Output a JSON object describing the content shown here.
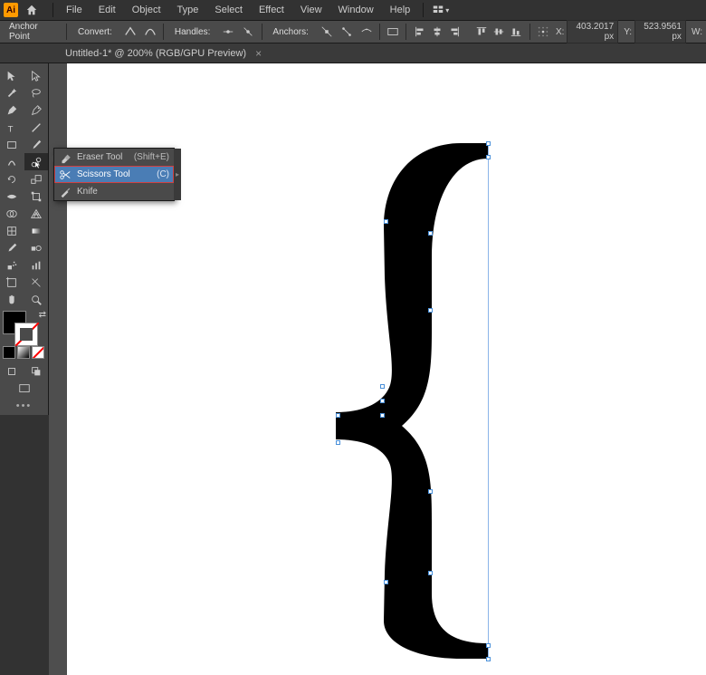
{
  "app": {
    "short": "Ai"
  },
  "menu": {
    "items": [
      "File",
      "Edit",
      "Object",
      "Type",
      "Select",
      "Effect",
      "View",
      "Window",
      "Help"
    ]
  },
  "controlbar": {
    "mode": "Anchor Point",
    "convert": "Convert:",
    "handles": "Handles:",
    "anchors": "Anchors:",
    "x_label": "X:",
    "y_label": "Y:",
    "x_value": "403.2017 px",
    "y_value": "523.9561 px",
    "w_label": "W:"
  },
  "tab": {
    "title": "Untitled-1* @ 200% (RGB/GPU Preview)",
    "close": "×"
  },
  "flyout": {
    "items": [
      {
        "icon": "eraser-icon",
        "name": "Eraser Tool",
        "shortcut": "(Shift+E)"
      },
      {
        "icon": "scissors-icon",
        "name": "Scissors Tool",
        "shortcut": "(C)"
      },
      {
        "icon": "knife-icon",
        "name": "Knife",
        "shortcut": ""
      }
    ]
  },
  "chart_data": null
}
